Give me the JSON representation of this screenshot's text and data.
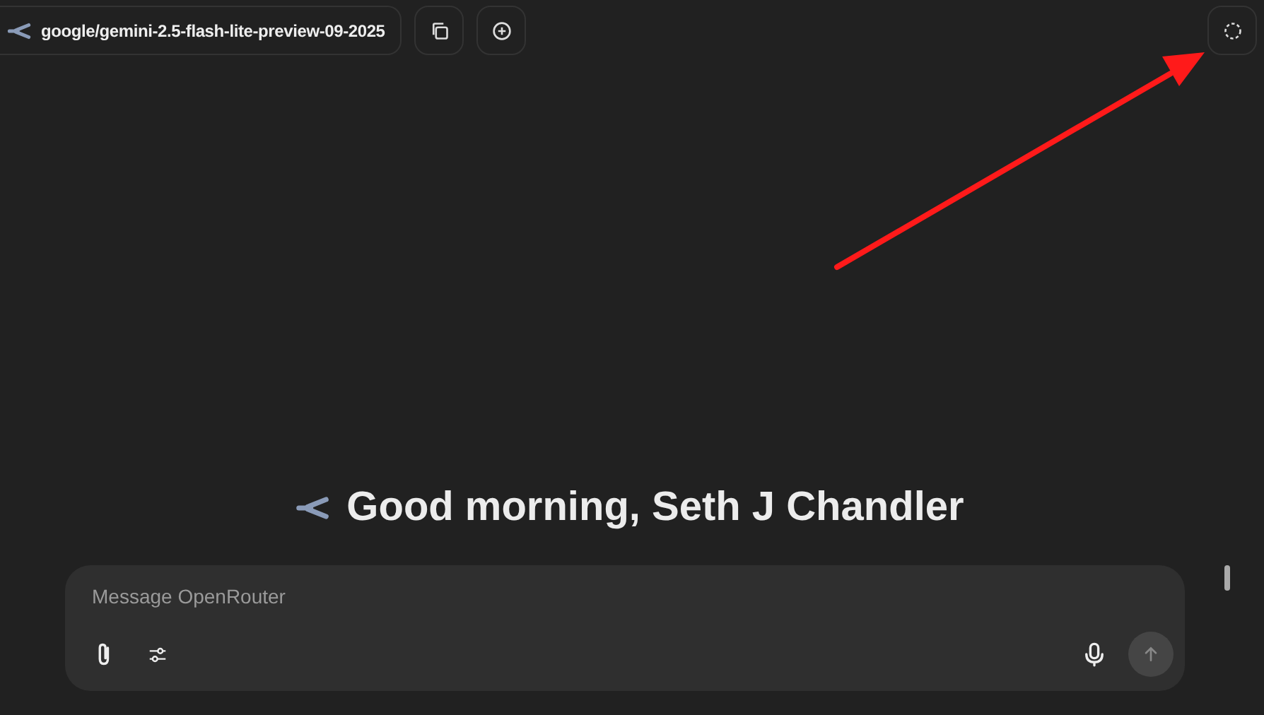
{
  "model_selector": {
    "label": "google/gemini-2.5-flash-lite-preview-09-2025"
  },
  "greeting": "Good morning, Seth J Chandler",
  "composer": {
    "placeholder": "Message OpenRouter",
    "send_disabled": true
  }
}
